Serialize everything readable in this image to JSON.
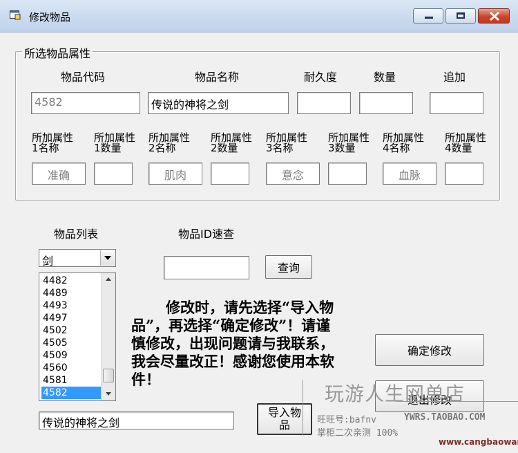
{
  "window": {
    "title": "修改物品"
  },
  "group": {
    "legend": "所选物品属性",
    "headers": [
      "物品代码",
      "物品名称",
      "耐久度",
      "数量",
      "追加"
    ],
    "item_code": "4582",
    "item_name": "传说的神将之剑",
    "durability": "",
    "quantity": "",
    "addition": "",
    "attr_labels": [
      [
        "所加属性",
        "1名称"
      ],
      [
        "所加属性",
        "1数量"
      ],
      [
        "所加属性",
        "2名称"
      ],
      [
        "所加属性",
        "2数量"
      ],
      [
        "所加属性",
        "3名称"
      ],
      [
        "所加属性",
        "3数量"
      ],
      [
        "所加属性",
        "4名称"
      ],
      [
        "所加属性",
        "4数量"
      ]
    ],
    "attr_values": [
      "准确",
      "",
      "肌肉",
      "",
      "意念",
      "",
      "血脉",
      ""
    ]
  },
  "list_section": {
    "list_label": "物品列表",
    "category": "剑",
    "items": [
      "4482",
      "4489",
      "4493",
      "4497",
      "4502",
      "4505",
      "4509",
      "4560",
      "4581",
      "4582"
    ],
    "selected": "4582",
    "selected_name": "传说的神将之剑"
  },
  "id_lookup": {
    "label": "物品ID速查",
    "value": "",
    "query_button": "查询"
  },
  "notice": "修改时，请先选择“导入物品”，再选择“确定修改”！请谨慎修改，出现问题请与我联系，我会尽量改正！感谢您使用本软件！",
  "buttons": {
    "confirm": "确定修改",
    "exit": "退出修改",
    "import": "导入物品"
  },
  "watermark": {
    "shop": "玩游人生网单店",
    "wangwang": "旺旺号:bafnv",
    "site_upper": "YWRS.TAOBAO.COM",
    "slogan": "掌柜二次亲测  100%",
    "domain": "www.cangbaowan.net"
  }
}
